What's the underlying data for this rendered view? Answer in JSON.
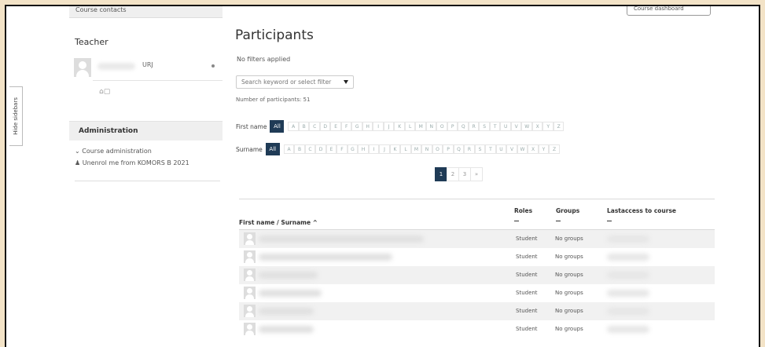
{
  "sidebar_toggle": {
    "label": "Hide sidebars"
  },
  "left": {
    "contacts_header": "Course contacts",
    "teacher_title": "Teacher",
    "teacher_name_suffix": "URJ",
    "admin_title": "Administration",
    "admin_items": [
      "Course administration",
      "Unenrol me from KOMORS B 2021"
    ]
  },
  "options_button": {
    "label": "Course dashboard"
  },
  "main": {
    "title": "Participants",
    "no_filters": "No filters applied",
    "filter_placeholder": "Search keyword or select filter",
    "count": "Number of participants: 51",
    "firstname_label": "First name",
    "surname_label": "Surname",
    "all_label": "All",
    "letters": [
      "A",
      "B",
      "C",
      "D",
      "E",
      "F",
      "G",
      "H",
      "I",
      "J",
      "K",
      "L",
      "M",
      "N",
      "O",
      "P",
      "Q",
      "R",
      "S",
      "T",
      "U",
      "V",
      "W",
      "X",
      "Y",
      "Z"
    ],
    "pages": [
      "1",
      "2",
      "3",
      "»"
    ],
    "active_page": "1"
  },
  "table": {
    "col_name": "First name / Surname ^",
    "col_roles": "Roles",
    "col_groups": "Groups",
    "col_last": "Lastaccess to course",
    "rows": [
      {
        "role": "Student",
        "group": "No groups"
      },
      {
        "role": "Student",
        "group": "No groups"
      },
      {
        "role": "Student",
        "group": "No groups"
      },
      {
        "role": "Student",
        "group": "No groups"
      },
      {
        "role": "Student",
        "group": "No groups"
      },
      {
        "role": "Student",
        "group": "No groups"
      }
    ]
  }
}
